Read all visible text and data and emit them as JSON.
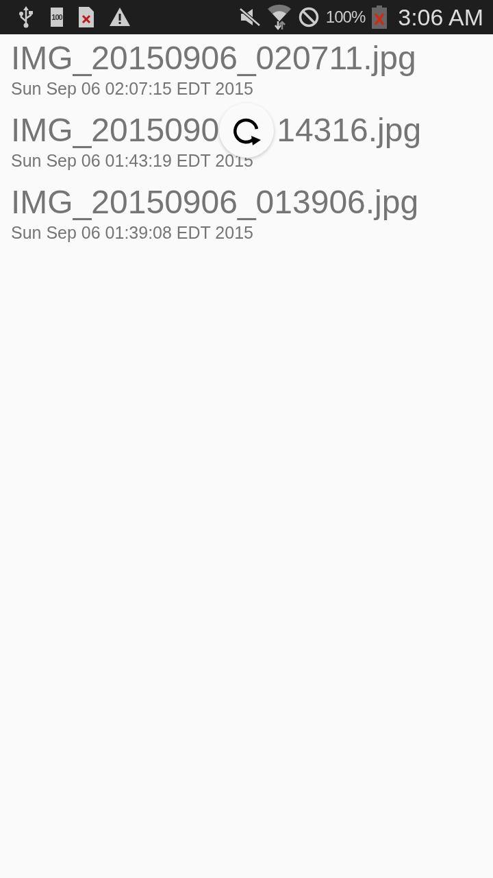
{
  "status_bar": {
    "battery_saver_label": "100",
    "battery_percent": "100%",
    "time": "3:06 AM"
  },
  "files": [
    {
      "name_parts": [
        "IMG_20150906_020711.jpg"
      ],
      "date": "Sun Sep 06 02:07:15 EDT 2015"
    },
    {
      "name_parts": [
        "IMG_2015090",
        "14316.jpg"
      ],
      "date": "Sun Sep 06 01:43:19 EDT 2015"
    },
    {
      "name_parts": [
        "IMG_20150906_013906.jpg"
      ],
      "date": "Sun Sep 06 01:39:08 EDT 2015"
    }
  ],
  "refresh_indicator": {
    "kind": "spinner"
  }
}
